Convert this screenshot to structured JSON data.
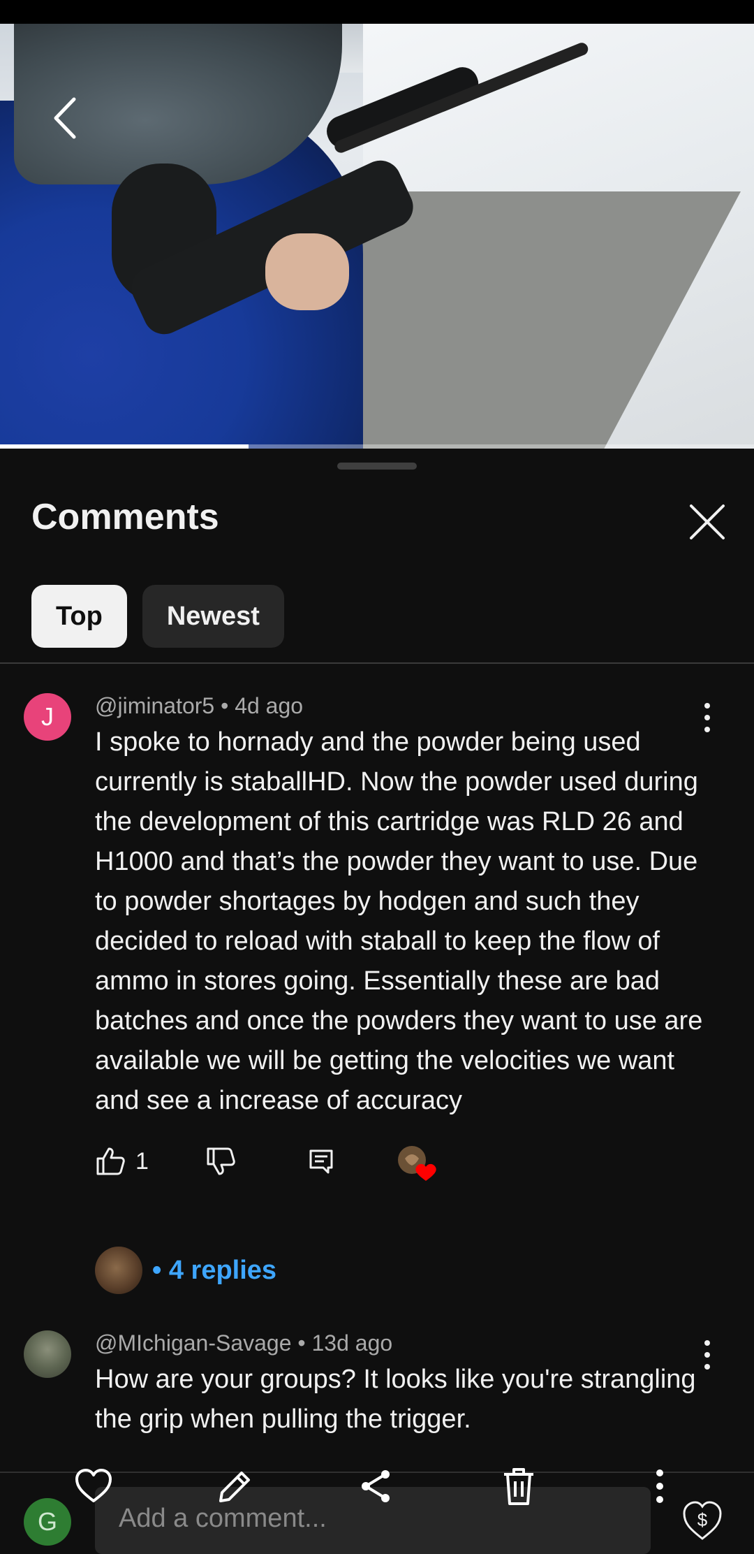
{
  "video": {
    "progress_fraction": 0.33
  },
  "sheet": {
    "title": "Comments",
    "filters": [
      {
        "label": "Top",
        "active": true
      },
      {
        "label": "Newest",
        "active": false
      }
    ]
  },
  "comments": [
    {
      "avatar_initial": "J",
      "avatar_color": "#e8437a",
      "author": "@jiminator5",
      "age": "4d ago",
      "text": "I spoke to hornady and the powder being used currently is staballHD. Now the powder used during the development of this cartridge was RLD 26 and H1000 and that’s the powder they want to use. Due to powder shortages by hodgen and such they decided to reload with staball to keep the flow of ammo in stores going. Essentially these are bad batches and once the powders they want to use are available we will be getting the velocities we want and see a increase of accuracy",
      "likes": "1",
      "replies_label": "• 4 replies"
    },
    {
      "author": "@MIchigan-Savage",
      "age": "13d ago",
      "text": "How are your groups? It looks like you're strangling the grip when pulling the trigger."
    }
  ],
  "composer": {
    "user_initial": "G",
    "placeholder": "Add a comment..."
  },
  "icons": [
    "back-icon",
    "close-icon",
    "kebab-menu-icon",
    "thumbs-up-icon",
    "thumbs-down-icon",
    "reply-icon",
    "creator-heart-icon",
    "heart-icon",
    "pencil-icon",
    "share-icon",
    "trash-icon",
    "super-thanks-icon"
  ],
  "colors": {
    "accent_link": "#3ea6ff",
    "heart_red": "#ff0000",
    "background": "#0f0f0f"
  }
}
